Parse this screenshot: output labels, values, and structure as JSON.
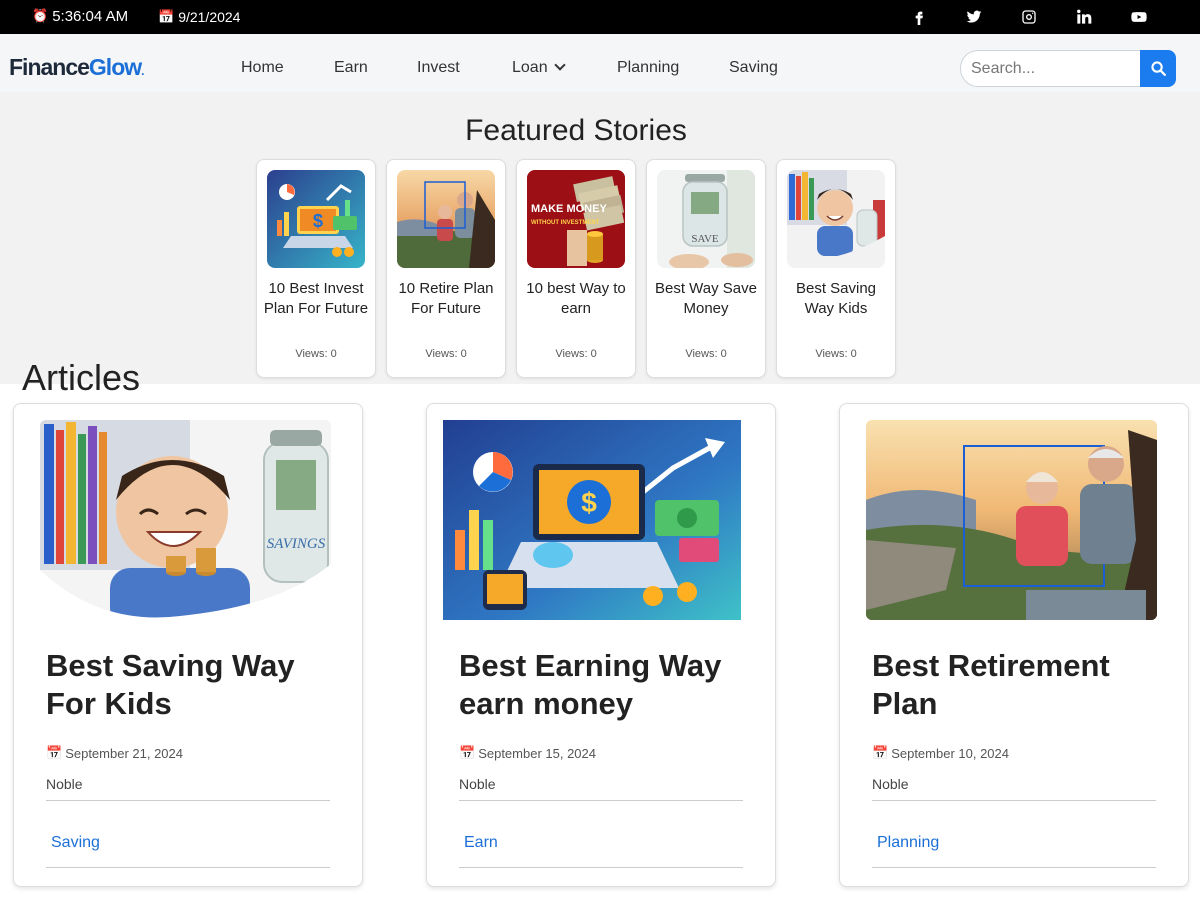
{
  "topbar": {
    "time_icon": "alarm-clock-icon",
    "time": "5:36:04 AM",
    "date_icon": "calendar-icon",
    "date": "9/21/2024",
    "social": [
      "facebook-icon",
      "twitter-icon",
      "instagram-icon",
      "linkedin-icon",
      "youtube-icon"
    ]
  },
  "brand": {
    "part1": "Finance",
    "part2": "Glow",
    "suffix": "."
  },
  "nav": {
    "items": [
      {
        "label": "Home"
      },
      {
        "label": "Earn"
      },
      {
        "label": "Invest"
      },
      {
        "label": "Loan"
      },
      {
        "label": "Planning"
      },
      {
        "label": "Saving"
      }
    ]
  },
  "search": {
    "placeholder": "Search...",
    "icon": "search-icon"
  },
  "featured": {
    "title": "Featured Stories",
    "items": [
      {
        "title": "10 Best Invest Plan For Future",
        "views": "Views: 0"
      },
      {
        "title": "10 Retire Plan For Future",
        "views": "Views: 0"
      },
      {
        "title": "10 best Way to earn",
        "views": "Views: 0"
      },
      {
        "title": "Best Way Save Money",
        "views": "Views: 0"
      },
      {
        "title": "Best Saving Way Kids",
        "views": "Views: 0"
      }
    ]
  },
  "articles": {
    "title": "Articles",
    "items": [
      {
        "title": "Best Saving Way For Kids",
        "date": "September 21, 2024",
        "author": "Noble",
        "category": "Saving"
      },
      {
        "title": "Best Earning Way earn money",
        "date": "September 15, 2024",
        "author": "Noble",
        "category": "Earn"
      },
      {
        "title": "Best Retirement Plan",
        "date": "September 10, 2024",
        "author": "Noble",
        "category": "Planning"
      }
    ]
  },
  "image_text": {
    "make_money": "MAKE MONEY",
    "without_investment": "WITHOUT INVESTMENT",
    "save": "SAVE",
    "savings": "SAVINGS"
  }
}
